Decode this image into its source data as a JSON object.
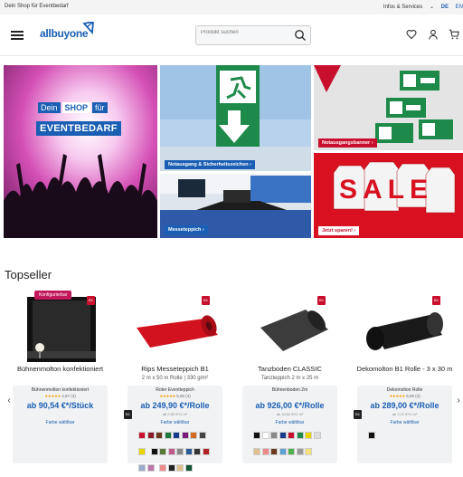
{
  "topbar": {
    "left": "Dein Shop für Eventbedarf",
    "info": "Infos & Services",
    "info_chevron": "⌄",
    "lang_de": "DE",
    "lang_en": "EN"
  },
  "header": {
    "logo": "allbuyone",
    "search_placeholder": "Produkt suchen",
    "icons": [
      "search-icon",
      "heart-icon",
      "user-icon",
      "cart-icon"
    ]
  },
  "hero": {
    "main_line1": "Dein",
    "main_shop": "SHOP",
    "main_fur": "für",
    "main_line2": "EVENTBEDARF",
    "tile_notausgang_label": "Notausgang & Sicherheitszeichen",
    "tile_messe_label": "Messeteppich",
    "tile_banner_label": "Notausgangsbanner",
    "tile_sale_label": "Jetzt sparen!",
    "sale_letters": [
      "S",
      "A",
      "L",
      "E"
    ],
    "arrow_glyph": "›"
  },
  "section_title": "Topseller",
  "sticker": "Konfigurierbar",
  "products": [
    {
      "name": "Bühnenmolton konfektioniert",
      "sub": "",
      "card_title": "Bühnenmolton konfektioniert",
      "rating": "4,67",
      "reviews": "(3)",
      "price": "ab 90,54 €*/Stück",
      "unit": "",
      "farbe": "Farbe wählbar"
    },
    {
      "name": "Rips Messeteppich B1",
      "sub": "2 m x 50 m Rolle | 330 g/m²",
      "card_title": "Roter Eventteppich",
      "rating": "5,00",
      "reviews": "(4)",
      "price": "ab 249,90 €*/Rolle",
      "unit": "ab 2,50 €*/1 m²",
      "farbe": "Farbe wählbar"
    },
    {
      "name": "Tanzboden CLASSIC",
      "sub": "Tanzteppich 2 m x 25 m",
      "card_title": "Bühnenboden 2m",
      "rating": "",
      "reviews": "",
      "price": "ab 926,00 €*/Rolle",
      "unit": "ab 18,52 €*/1 m²",
      "farbe": "Farbe wählbar"
    },
    {
      "name": "Dekomolton B1 Rolle - 3 x 30 m",
      "sub": "",
      "card_title": "Dekomolton Rolle",
      "rating": "5,00",
      "reviews": "(4)",
      "price": "ab 289,00 €*/Rolle",
      "unit": "ab 3,21 €*/1 m²",
      "farbe": "Farbe wählbar"
    }
  ],
  "badge_text": "B1",
  "nav": {
    "prev": "‹",
    "next": "›"
  },
  "colors": {
    "brand_blue": "#1a5fb4",
    "sale_red": "#c8102e",
    "star": "#f1a400",
    "sticker": "#c2185b"
  }
}
